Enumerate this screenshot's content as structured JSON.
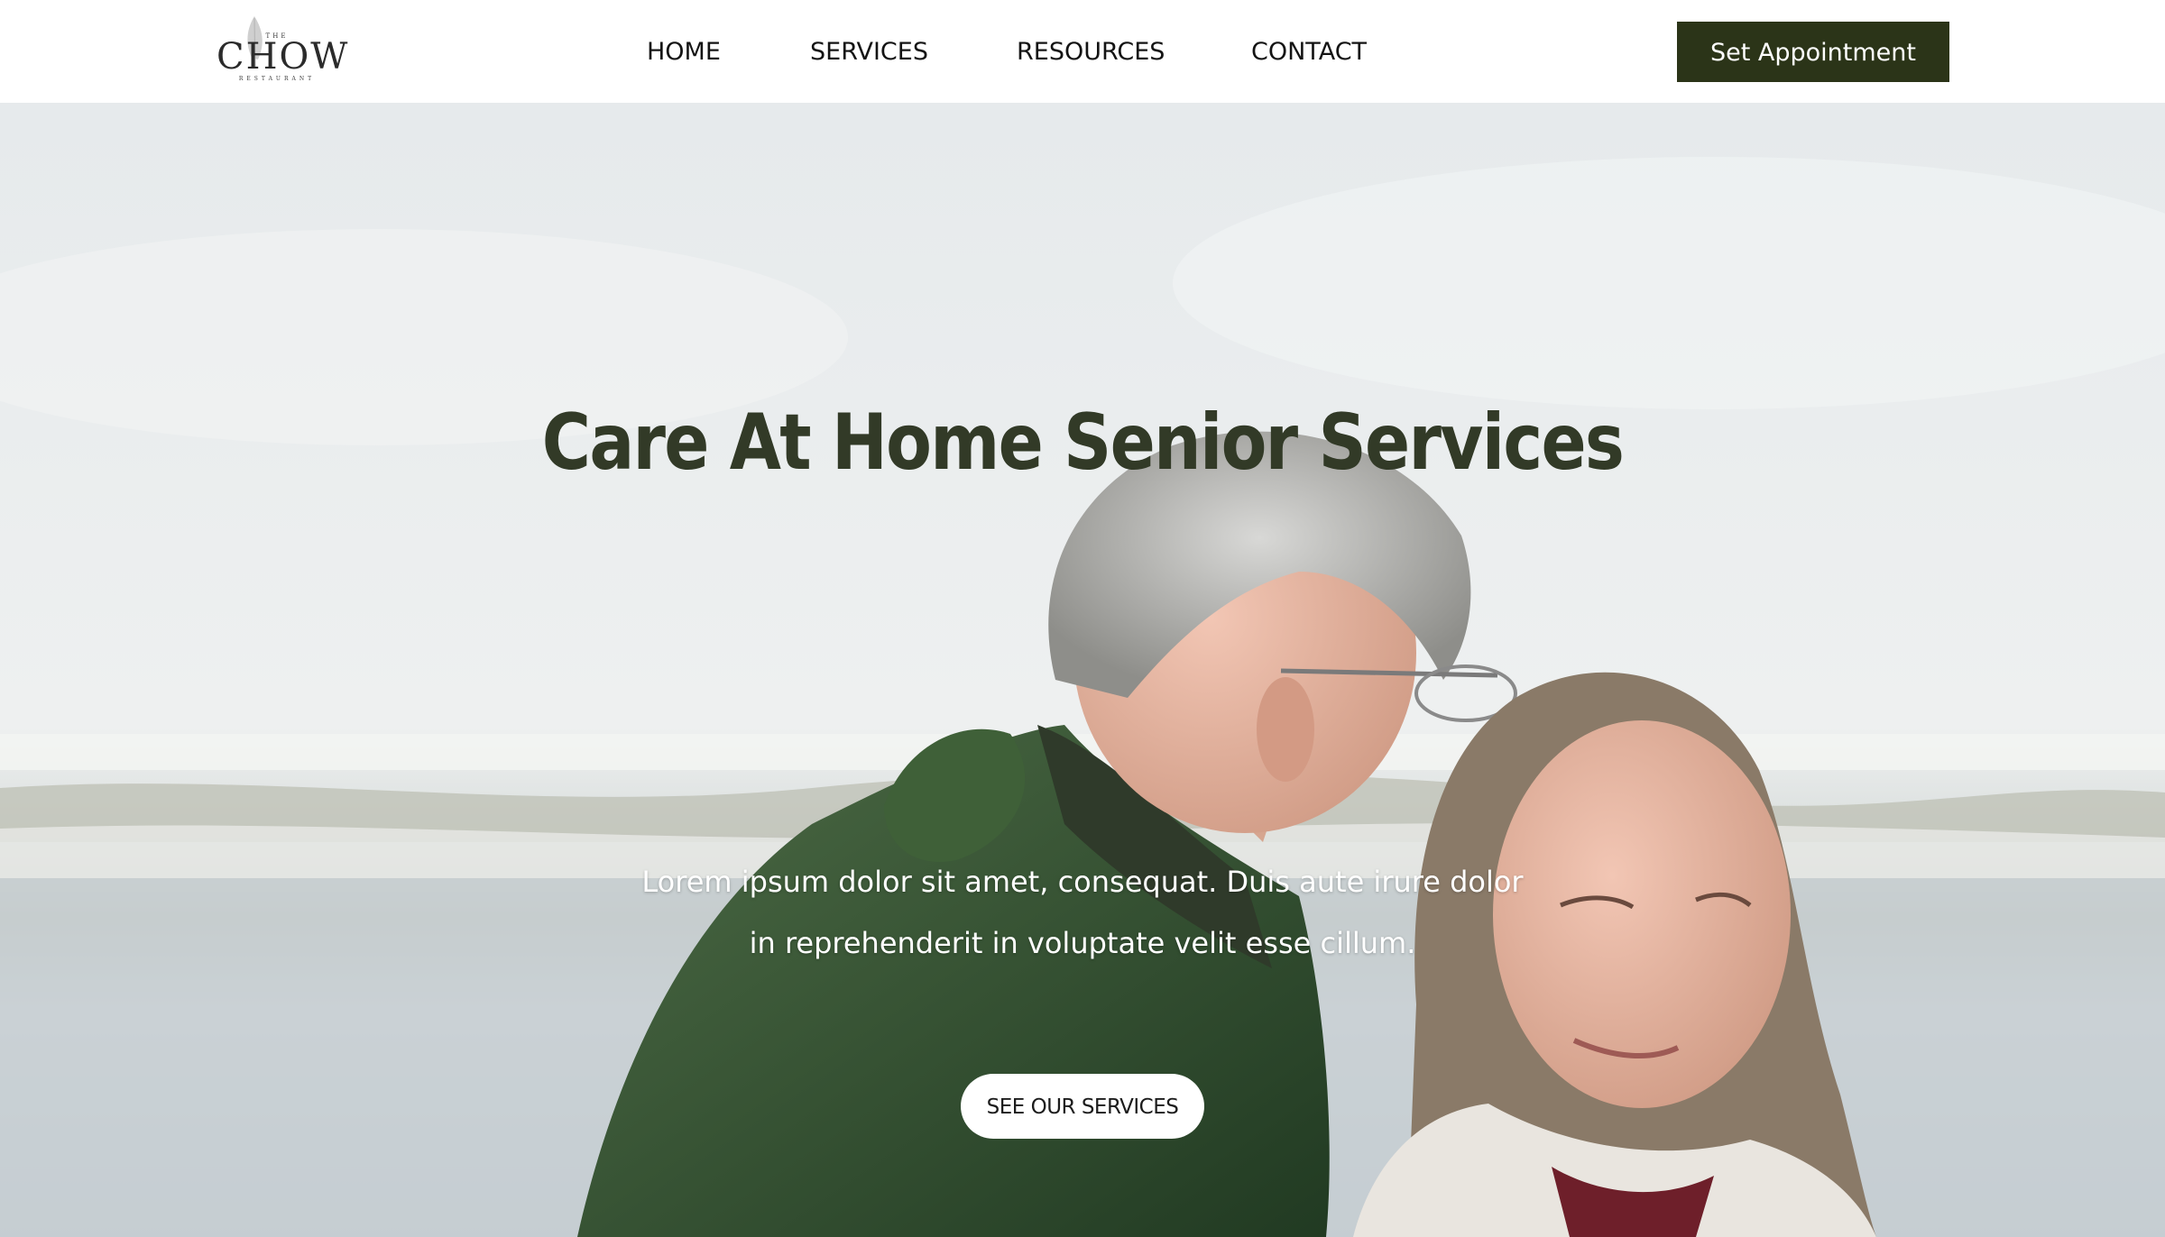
{
  "header": {
    "logo": {
      "top_text": "THE",
      "main_text": "CHOW",
      "sub_text": "RESTAURANT"
    },
    "nav": [
      {
        "label": "HOME"
      },
      {
        "label": "SERVICES"
      },
      {
        "label": "RESOURCES"
      },
      {
        "label": "CONTACT"
      }
    ],
    "cta_label": "Set Appointment"
  },
  "hero": {
    "title": "Care At Home Senior Services",
    "text_line_1": "Lorem ipsum dolor sit amet, consequat. Duis aute irure dolor",
    "text_line_2": "in reprehenderit in voluptate velit esse cillum.",
    "button_label": "SEE OUR SERVICES"
  },
  "colors": {
    "accent": "#2b3418",
    "title": "#323a27",
    "background": "#ffffff"
  }
}
